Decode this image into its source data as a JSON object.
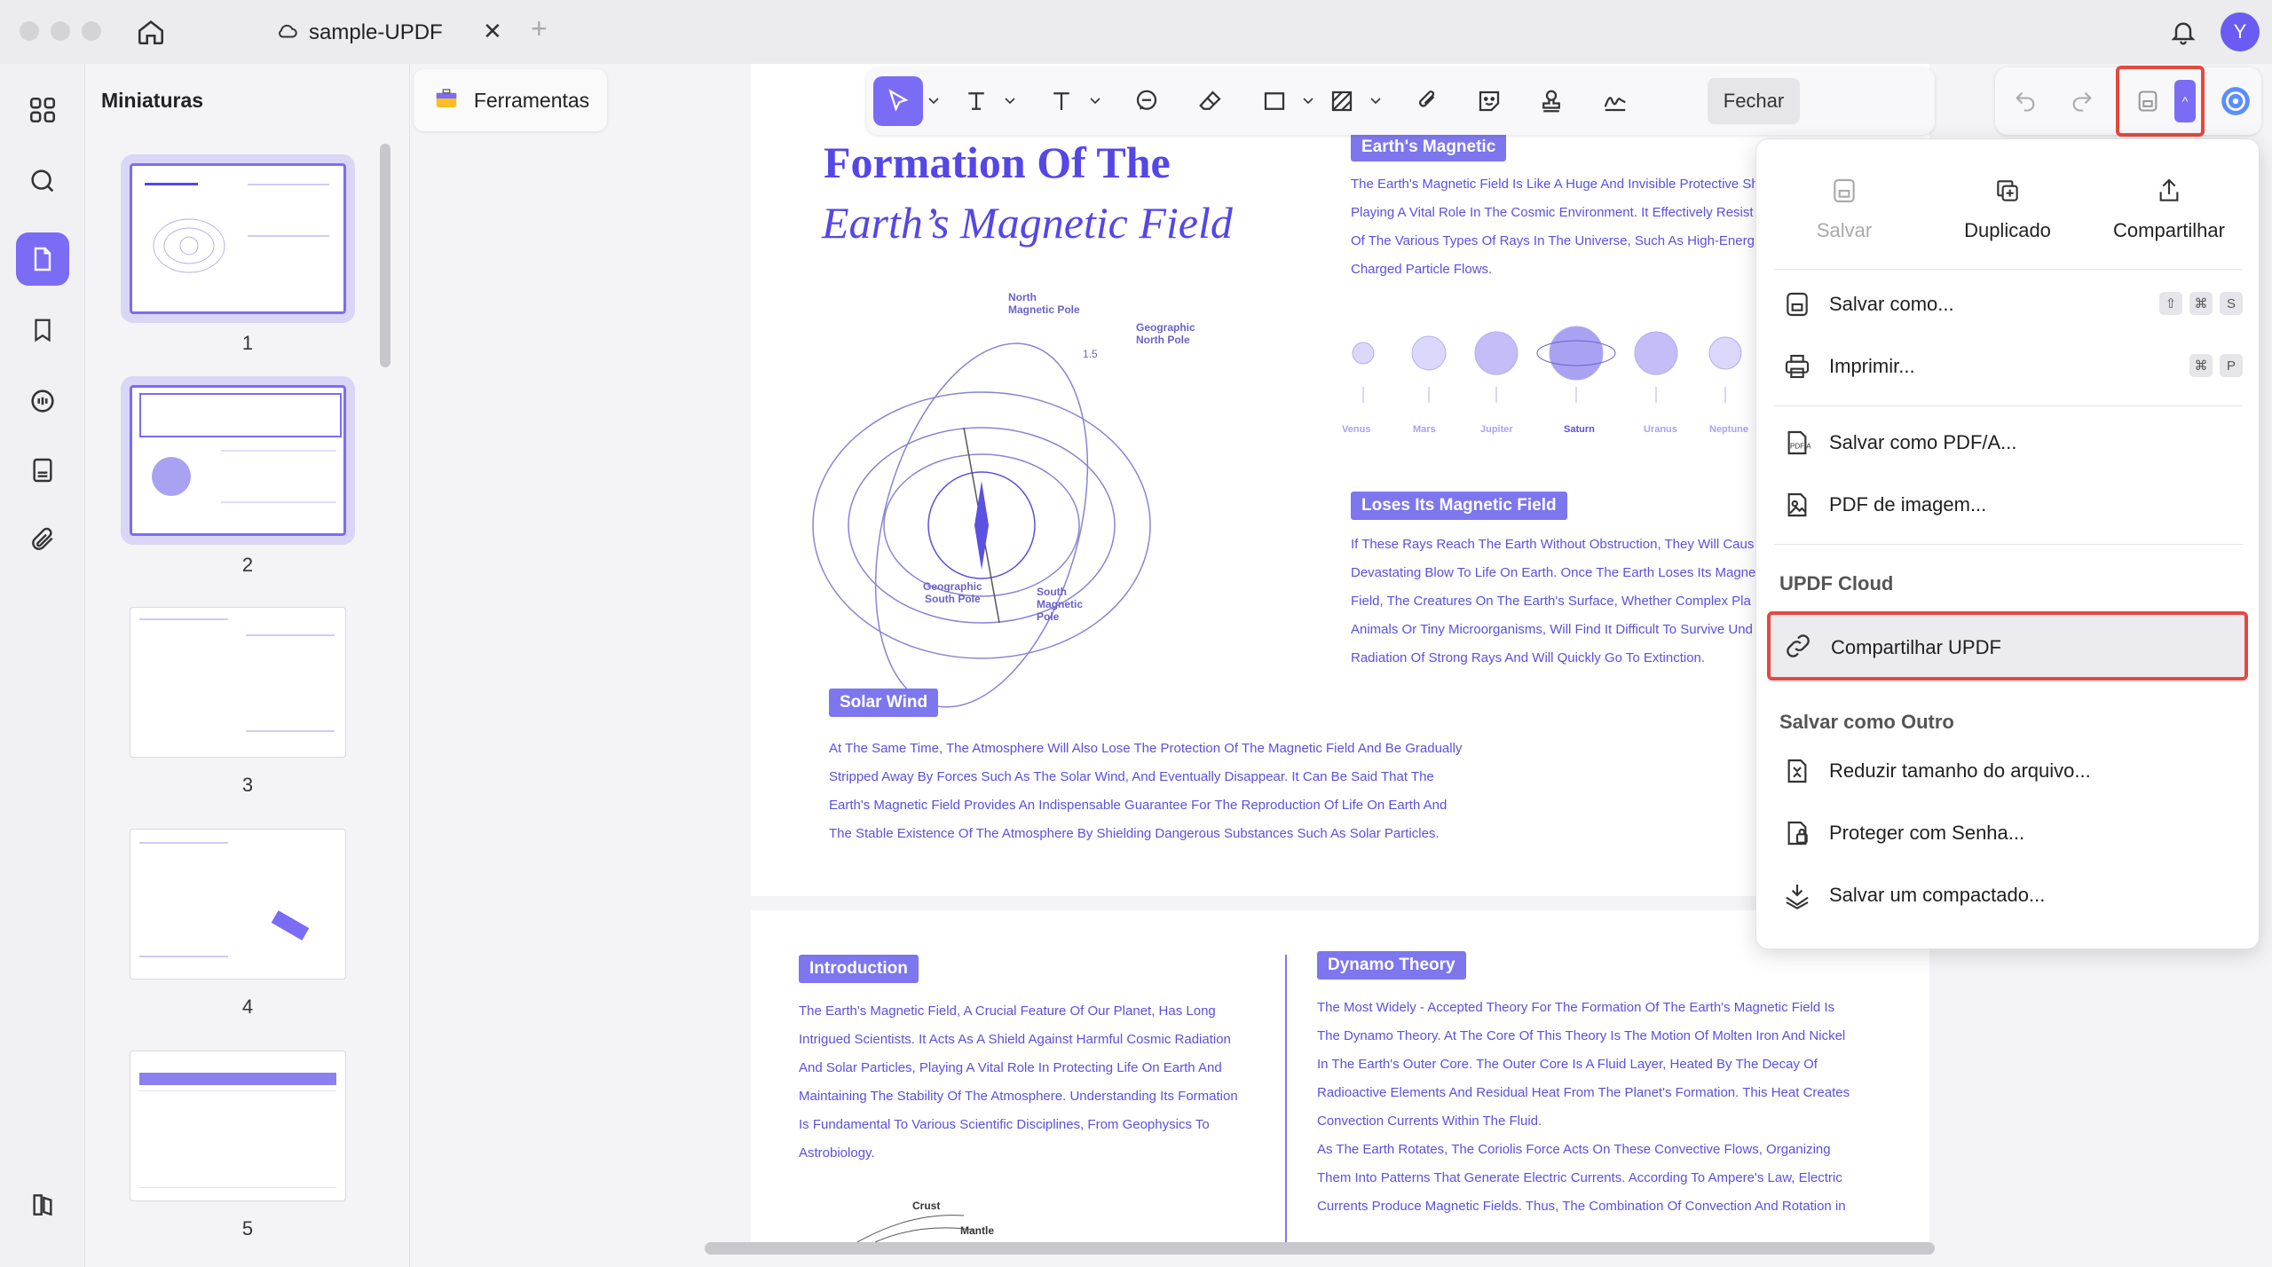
{
  "tab": {
    "title": "sample-UPDF"
  },
  "user": {
    "initial": "Y"
  },
  "sidebar": {
    "title": "Miniaturas"
  },
  "thumbnails": [
    "1",
    "2",
    "3",
    "4",
    "5"
  ],
  "tools_button": {
    "label": "Ferramentas"
  },
  "toolbar": {
    "close_label": "Fechar"
  },
  "page1": {
    "title_line1": "Formation Of The",
    "title_line2": "Earth’s Magnetic Field",
    "diagram_labels": {
      "north": "North\nMagnetic Pole",
      "geo_north": "Geographic\nNorth Pole",
      "angle": "1.5",
      "geo_south": "Geographic\nSouth Pole",
      "south": "South\nMagnetic\nPole"
    },
    "section1": {
      "heading": "Earth's Magnetic",
      "lines": [
        "The Earth's Magnetic Field Is Like A Huge And Invisible Protective Sh",
        "Playing A Vital Role In The Cosmic Environment. It Effectively Resist",
        "Of The Various Types Of Rays In The Universe, Such As High-Energ",
        "Charged Particle Flows."
      ]
    },
    "planets": [
      "Venus",
      "Mars",
      "Jupiter",
      "Saturn",
      "Uranus",
      "Neptune"
    ],
    "section2": {
      "heading": "Loses Its Magnetic Field",
      "lines": [
        "If These Rays Reach The Earth Without Obstruction, They Will Caus",
        "Devastating Blow To Life On Earth. Once The Earth Loses Its Magne",
        "Field, The Creatures On The Earth's Surface, Whether Complex Pla",
        "Animals Or Tiny Microorganisms, Will Find It Difficult To Survive Und",
        "Radiation Of Strong Rays And Will Quickly Go To Extinction."
      ]
    },
    "section3": {
      "heading": "Solar Wind",
      "lines": [
        "At The Same Time, The Atmosphere Will Also Lose The Protection Of The Magnetic Field And Be Gradually",
        "Stripped Away By Forces Such As The Solar Wind, And Eventually Disappear. It Can Be Said That The",
        "Earth's Magnetic Field Provides An Indispensable Guarantee For The Reproduction Of Life On Earth And",
        "The Stable Existence Of The Atmosphere By Shielding Dangerous Substances Such As Solar Particles."
      ]
    }
  },
  "page2": {
    "intro": {
      "heading": "Introduction",
      "lines": [
        "The Earth's Magnetic Field, A Crucial Feature Of Our Planet, Has Long",
        "Intrigued Scientists. It Acts As A Shield Against Harmful Cosmic Radiation",
        "And Solar Particles, Playing A Vital Role In Protecting Life On Earth And",
        "Maintaining The Stability Of The Atmosphere. Understanding Its Formation",
        "Is Fundamental To Various Scientific Disciplines, From Geophysics To",
        "Astrobiology."
      ]
    },
    "dynamo": {
      "heading": "Dynamo Theory",
      "lines": [
        "The Most Widely - Accepted Theory For The Formation Of The Earth's Magnetic Field Is",
        "The Dynamo Theory. At The Core Of This Theory Is The Motion Of Molten Iron And Nickel",
        "In The Earth's Outer Core. The Outer Core Is A Fluid Layer, Heated By The Decay Of",
        "Radioactive Elements And Residual Heat From The Planet's Formation. This Heat Creates",
        "Convection Currents Within The Fluid.",
        "As The Earth Rotates, The Coriolis Force Acts On These Convective Flows, Organizing",
        "Them Into Patterns That Generate Electric Currents. According To Ampere's Law, Electric",
        "Currents Produce Magnetic Fields. Thus, The Combination Of Convection And Rotation in"
      ]
    },
    "labels": {
      "crust": "Crust",
      "mantle": "Mantle"
    }
  },
  "menu": {
    "top": [
      {
        "label": "Salvar",
        "icon": "save-icon",
        "disabled": true
      },
      {
        "label": "Duplicado",
        "icon": "duplicate-icon",
        "disabled": false
      },
      {
        "label": "Compartilhar",
        "icon": "share-icon",
        "disabled": false
      }
    ],
    "items": [
      {
        "label": "Salvar como...",
        "icon": "save-as-icon",
        "keys": [
          "⇧",
          "⌘",
          "S"
        ]
      },
      {
        "label": "Imprimir...",
        "icon": "print-icon",
        "keys": [
          "⌘",
          "P"
        ]
      },
      {
        "label": "Salvar como PDF/A...",
        "icon": "pdfa-icon",
        "keys": []
      },
      {
        "label": "PDF de imagem...",
        "icon": "image-pdf-icon",
        "keys": []
      }
    ],
    "cloud_title": "UPDF Cloud",
    "cloud_item": {
      "label": "Compartilhar UPDF",
      "icon": "link-icon"
    },
    "other_title": "Salvar como Outro",
    "other_items": [
      {
        "label": "Reduzir tamanho do arquivo...",
        "icon": "compress-icon"
      },
      {
        "label": "Proteger com Senha...",
        "icon": "lock-icon"
      },
      {
        "label": "Salvar um compactado...",
        "icon": "archive-icon"
      }
    ]
  },
  "colors": {
    "accent": "#7b6cf6",
    "highlight": "#e5483f",
    "text_purple": "#5b50e0"
  }
}
